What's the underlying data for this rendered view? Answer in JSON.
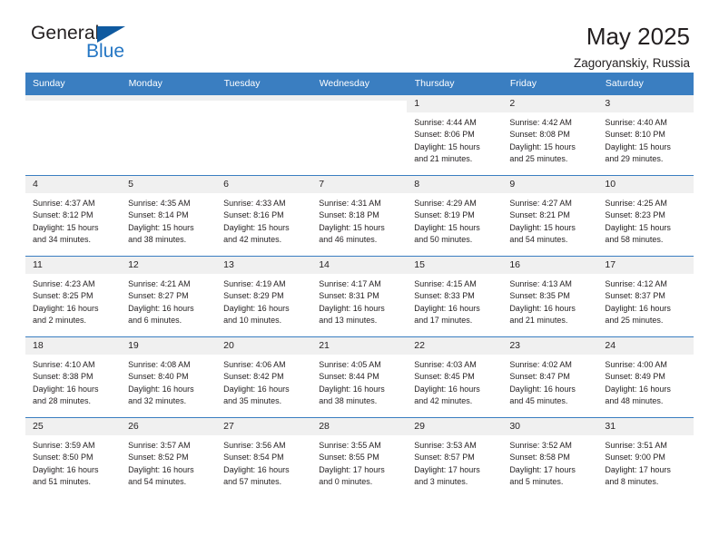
{
  "brand": {
    "name_top": "General",
    "name_bottom": "Blue",
    "accent_color": "#2476c4",
    "mark_color": "#0f5aa0"
  },
  "header": {
    "title": "May 2025",
    "subtitle": "Zagoryanskiy, Russia"
  },
  "theme": {
    "header_row_bg": "#3a7ec1",
    "header_row_text": "#ffffff",
    "daynum_bg": "#f0f0f0",
    "text": "#231f20"
  },
  "weekday_headers": [
    "Sunday",
    "Monday",
    "Tuesday",
    "Wednesday",
    "Thursday",
    "Friday",
    "Saturday"
  ],
  "weeks": [
    [
      {
        "day": "",
        "empty": true
      },
      {
        "day": "",
        "empty": true
      },
      {
        "day": "",
        "empty": true
      },
      {
        "day": "",
        "empty": true
      },
      {
        "day": "1",
        "sunrise": "Sunrise: 4:44 AM",
        "sunset": "Sunset: 8:06 PM",
        "daylight_1": "Daylight: 15 hours",
        "daylight_2": "and 21 minutes."
      },
      {
        "day": "2",
        "sunrise": "Sunrise: 4:42 AM",
        "sunset": "Sunset: 8:08 PM",
        "daylight_1": "Daylight: 15 hours",
        "daylight_2": "and 25 minutes."
      },
      {
        "day": "3",
        "sunrise": "Sunrise: 4:40 AM",
        "sunset": "Sunset: 8:10 PM",
        "daylight_1": "Daylight: 15 hours",
        "daylight_2": "and 29 minutes."
      }
    ],
    [
      {
        "day": "4",
        "sunrise": "Sunrise: 4:37 AM",
        "sunset": "Sunset: 8:12 PM",
        "daylight_1": "Daylight: 15 hours",
        "daylight_2": "and 34 minutes."
      },
      {
        "day": "5",
        "sunrise": "Sunrise: 4:35 AM",
        "sunset": "Sunset: 8:14 PM",
        "daylight_1": "Daylight: 15 hours",
        "daylight_2": "and 38 minutes."
      },
      {
        "day": "6",
        "sunrise": "Sunrise: 4:33 AM",
        "sunset": "Sunset: 8:16 PM",
        "daylight_1": "Daylight: 15 hours",
        "daylight_2": "and 42 minutes."
      },
      {
        "day": "7",
        "sunrise": "Sunrise: 4:31 AM",
        "sunset": "Sunset: 8:18 PM",
        "daylight_1": "Daylight: 15 hours",
        "daylight_2": "and 46 minutes."
      },
      {
        "day": "8",
        "sunrise": "Sunrise: 4:29 AM",
        "sunset": "Sunset: 8:19 PM",
        "daylight_1": "Daylight: 15 hours",
        "daylight_2": "and 50 minutes."
      },
      {
        "day": "9",
        "sunrise": "Sunrise: 4:27 AM",
        "sunset": "Sunset: 8:21 PM",
        "daylight_1": "Daylight: 15 hours",
        "daylight_2": "and 54 minutes."
      },
      {
        "day": "10",
        "sunrise": "Sunrise: 4:25 AM",
        "sunset": "Sunset: 8:23 PM",
        "daylight_1": "Daylight: 15 hours",
        "daylight_2": "and 58 minutes."
      }
    ],
    [
      {
        "day": "11",
        "sunrise": "Sunrise: 4:23 AM",
        "sunset": "Sunset: 8:25 PM",
        "daylight_1": "Daylight: 16 hours",
        "daylight_2": "and 2 minutes."
      },
      {
        "day": "12",
        "sunrise": "Sunrise: 4:21 AM",
        "sunset": "Sunset: 8:27 PM",
        "daylight_1": "Daylight: 16 hours",
        "daylight_2": "and 6 minutes."
      },
      {
        "day": "13",
        "sunrise": "Sunrise: 4:19 AM",
        "sunset": "Sunset: 8:29 PM",
        "daylight_1": "Daylight: 16 hours",
        "daylight_2": "and 10 minutes."
      },
      {
        "day": "14",
        "sunrise": "Sunrise: 4:17 AM",
        "sunset": "Sunset: 8:31 PM",
        "daylight_1": "Daylight: 16 hours",
        "daylight_2": "and 13 minutes."
      },
      {
        "day": "15",
        "sunrise": "Sunrise: 4:15 AM",
        "sunset": "Sunset: 8:33 PM",
        "daylight_1": "Daylight: 16 hours",
        "daylight_2": "and 17 minutes."
      },
      {
        "day": "16",
        "sunrise": "Sunrise: 4:13 AM",
        "sunset": "Sunset: 8:35 PM",
        "daylight_1": "Daylight: 16 hours",
        "daylight_2": "and 21 minutes."
      },
      {
        "day": "17",
        "sunrise": "Sunrise: 4:12 AM",
        "sunset": "Sunset: 8:37 PM",
        "daylight_1": "Daylight: 16 hours",
        "daylight_2": "and 25 minutes."
      }
    ],
    [
      {
        "day": "18",
        "sunrise": "Sunrise: 4:10 AM",
        "sunset": "Sunset: 8:38 PM",
        "daylight_1": "Daylight: 16 hours",
        "daylight_2": "and 28 minutes."
      },
      {
        "day": "19",
        "sunrise": "Sunrise: 4:08 AM",
        "sunset": "Sunset: 8:40 PM",
        "daylight_1": "Daylight: 16 hours",
        "daylight_2": "and 32 minutes."
      },
      {
        "day": "20",
        "sunrise": "Sunrise: 4:06 AM",
        "sunset": "Sunset: 8:42 PM",
        "daylight_1": "Daylight: 16 hours",
        "daylight_2": "and 35 minutes."
      },
      {
        "day": "21",
        "sunrise": "Sunrise: 4:05 AM",
        "sunset": "Sunset: 8:44 PM",
        "daylight_1": "Daylight: 16 hours",
        "daylight_2": "and 38 minutes."
      },
      {
        "day": "22",
        "sunrise": "Sunrise: 4:03 AM",
        "sunset": "Sunset: 8:45 PM",
        "daylight_1": "Daylight: 16 hours",
        "daylight_2": "and 42 minutes."
      },
      {
        "day": "23",
        "sunrise": "Sunrise: 4:02 AM",
        "sunset": "Sunset: 8:47 PM",
        "daylight_1": "Daylight: 16 hours",
        "daylight_2": "and 45 minutes."
      },
      {
        "day": "24",
        "sunrise": "Sunrise: 4:00 AM",
        "sunset": "Sunset: 8:49 PM",
        "daylight_1": "Daylight: 16 hours",
        "daylight_2": "and 48 minutes."
      }
    ],
    [
      {
        "day": "25",
        "sunrise": "Sunrise: 3:59 AM",
        "sunset": "Sunset: 8:50 PM",
        "daylight_1": "Daylight: 16 hours",
        "daylight_2": "and 51 minutes."
      },
      {
        "day": "26",
        "sunrise": "Sunrise: 3:57 AM",
        "sunset": "Sunset: 8:52 PM",
        "daylight_1": "Daylight: 16 hours",
        "daylight_2": "and 54 minutes."
      },
      {
        "day": "27",
        "sunrise": "Sunrise: 3:56 AM",
        "sunset": "Sunset: 8:54 PM",
        "daylight_1": "Daylight: 16 hours",
        "daylight_2": "and 57 minutes."
      },
      {
        "day": "28",
        "sunrise": "Sunrise: 3:55 AM",
        "sunset": "Sunset: 8:55 PM",
        "daylight_1": "Daylight: 17 hours",
        "daylight_2": "and 0 minutes."
      },
      {
        "day": "29",
        "sunrise": "Sunrise: 3:53 AM",
        "sunset": "Sunset: 8:57 PM",
        "daylight_1": "Daylight: 17 hours",
        "daylight_2": "and 3 minutes."
      },
      {
        "day": "30",
        "sunrise": "Sunrise: 3:52 AM",
        "sunset": "Sunset: 8:58 PM",
        "daylight_1": "Daylight: 17 hours",
        "daylight_2": "and 5 minutes."
      },
      {
        "day": "31",
        "sunrise": "Sunrise: 3:51 AM",
        "sunset": "Sunset: 9:00 PM",
        "daylight_1": "Daylight: 17 hours",
        "daylight_2": "and 8 minutes."
      }
    ]
  ]
}
